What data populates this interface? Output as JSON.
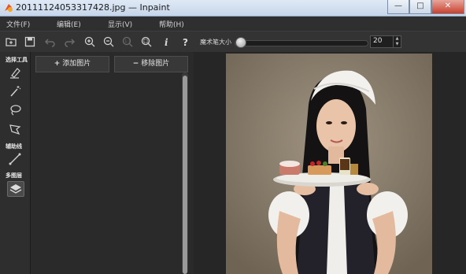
{
  "window": {
    "title": "20111124053317428.jpg — Inpaint",
    "minimize": "—",
    "maximize": "□",
    "close": "✕"
  },
  "menu": [
    "文件(F)",
    "编辑(E)",
    "显示(V)",
    "帮助(H)"
  ],
  "toolbar": {
    "brush_size_label": "魔术笔大小",
    "brush_size_value": "20"
  },
  "left_panel": {
    "selection_tools_label": "选择工具",
    "guides_label": "辅助线",
    "multilayer_label": "多图层"
  },
  "image_panel": {
    "add_label": "添加图片",
    "remove_label": "移除图片"
  }
}
